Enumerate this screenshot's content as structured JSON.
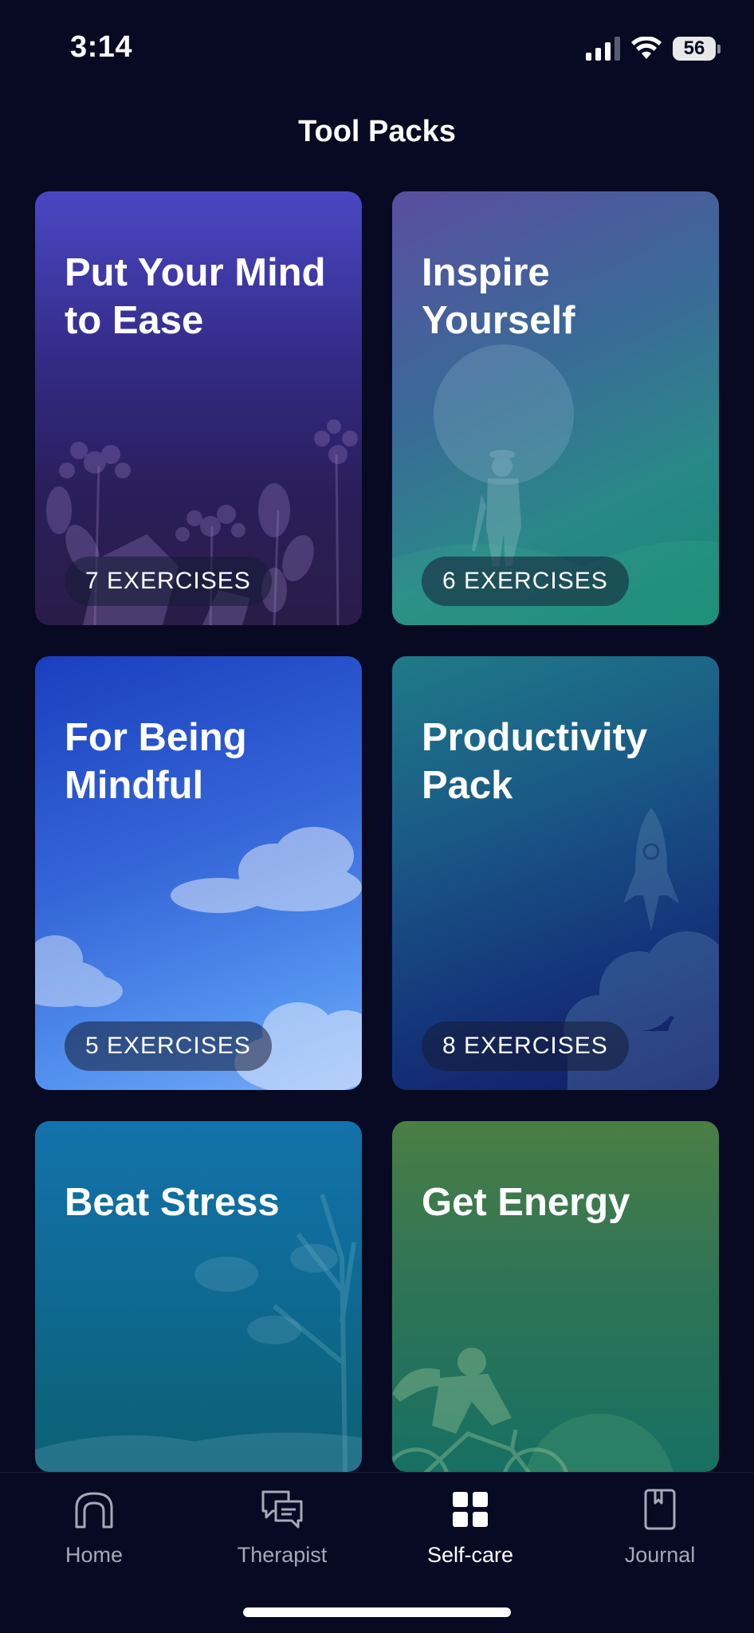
{
  "status_bar": {
    "time": "3:14",
    "battery": "56",
    "icons": [
      "cellular-signal-icon",
      "wifi-icon",
      "battery-icon"
    ]
  },
  "header": {
    "title": "Tool Packs"
  },
  "packs": [
    {
      "title": "Put Your Mind to Ease",
      "badge": "7 EXERCISES"
    },
    {
      "title": "Inspire Yourself",
      "badge": "6 EXERCISES"
    },
    {
      "title": "For Being Mindful",
      "badge": "5 EXERCISES"
    },
    {
      "title": "Productivity Pack",
      "badge": "8 EXERCISES"
    },
    {
      "title": "Beat Stress"
    },
    {
      "title": "Get Energy"
    }
  ],
  "tabbar": {
    "active": "Self-care",
    "tabs": [
      {
        "label": "Home",
        "icon": "home-icon"
      },
      {
        "label": "Therapist",
        "icon": "chat-bubbles-icon"
      },
      {
        "label": "Self-care",
        "icon": "grid-icon"
      },
      {
        "label": "Journal",
        "icon": "journal-icon"
      }
    ]
  },
  "colors": {
    "background": "#070a22",
    "active_tab": "#ffffff",
    "inactive_tab": "#a6a9b8"
  }
}
